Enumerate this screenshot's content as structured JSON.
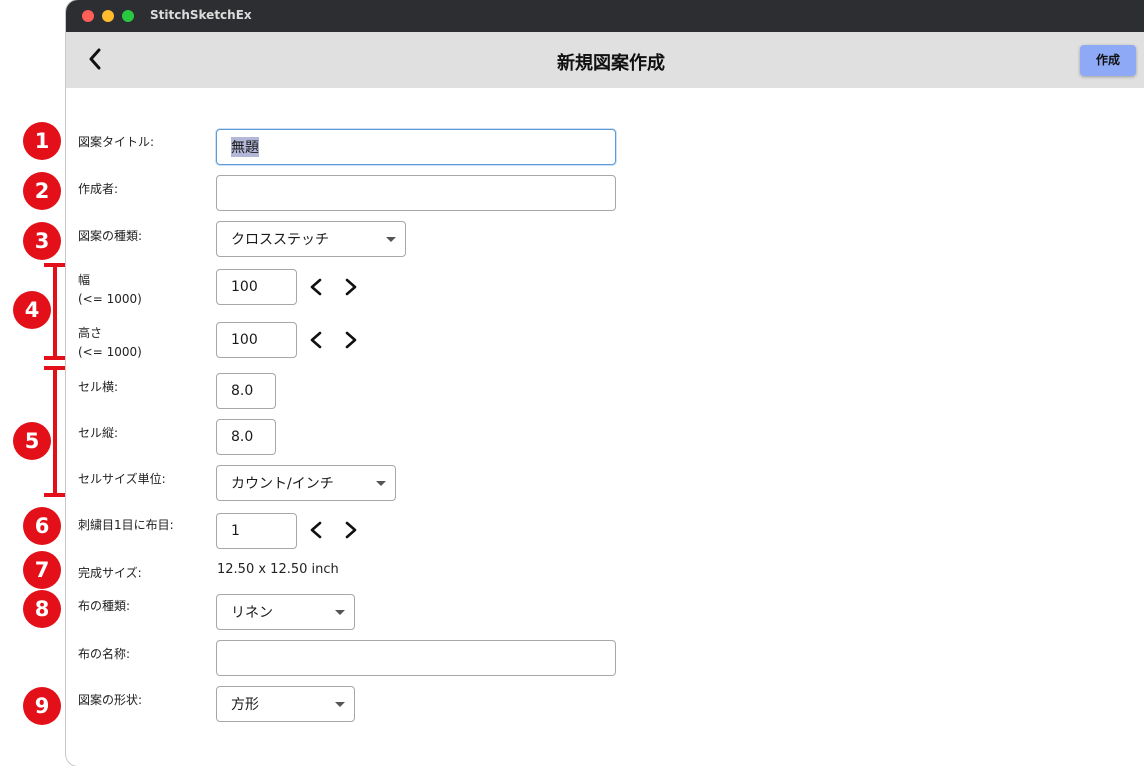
{
  "window": {
    "app_title": "StitchSketchEx"
  },
  "header": {
    "title": "新規図案作成",
    "create_label": "作成"
  },
  "badges": [
    "1",
    "2",
    "3",
    "4",
    "5",
    "6",
    "7",
    "8",
    "9"
  ],
  "form": {
    "title_label": "図案タイトル:",
    "title_value": "無題",
    "author_label": "作成者:",
    "author_value": "",
    "pattern_type_label": "図案の種類:",
    "pattern_type_value": "クロスステッチ",
    "width_label": "幅",
    "width_limit": "(<= 1000)",
    "width_value": "100",
    "height_label": "高さ",
    "height_limit": "(<= 1000)",
    "height_value": "100",
    "cell_h_label": "セル横:",
    "cell_h_value": "8.0",
    "cell_v_label": "セル縦:",
    "cell_v_value": "8.0",
    "cell_unit_label": "セルサイズ単位:",
    "cell_unit_value": "カウント/インチ",
    "stitch_label": "刺繍目1目に布目:",
    "stitch_value": "1",
    "finished_label": "完成サイズ:",
    "finished_value": "12.50 x 12.50 inch",
    "fabric_type_label": "布の種類:",
    "fabric_type_value": "リネン",
    "fabric_name_label": "布の名称:",
    "fabric_name_value": "",
    "shape_label": "図案の形状:",
    "shape_value": "方形"
  },
  "colors": {
    "annotation": "#e3101a",
    "button": "#8ea9f5",
    "appbar": "#e0e0e0"
  },
  "icons": {
    "back": "chevron-left-icon",
    "decrement": "chevron-left-icon",
    "increment": "chevron-right-icon",
    "dropdown": "caret-down-icon"
  }
}
